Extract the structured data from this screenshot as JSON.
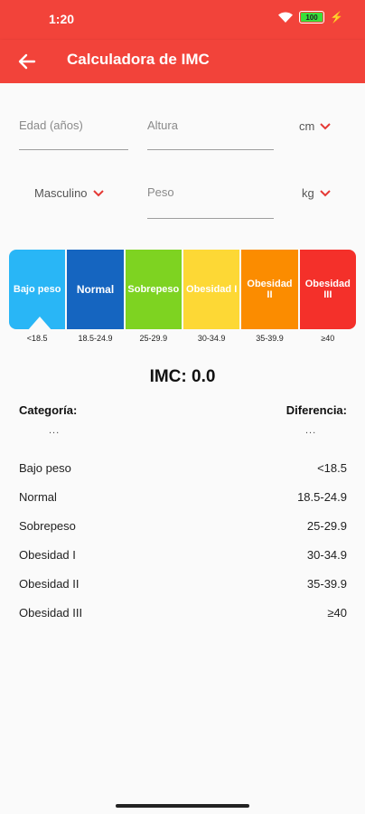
{
  "status": {
    "time": "1:20",
    "battery": "100"
  },
  "appbar": {
    "title": "Calculadora de IMC"
  },
  "form": {
    "age_placeholder": "Edad (años)",
    "height_placeholder": "Altura",
    "height_unit": "cm",
    "sex": "Masculino",
    "weight_placeholder": "Peso",
    "weight_unit": "kg"
  },
  "scale": {
    "segments": [
      {
        "label": "Bajo peso",
        "color": "#29b6f6"
      },
      {
        "label": "Normal",
        "color": "#1565c0"
      },
      {
        "label": "Sobrepeso",
        "color": "#7ed321"
      },
      {
        "label": "Obesidad I",
        "color": "#fdd835"
      },
      {
        "label": "Obesidad II",
        "color": "#fb8c00"
      },
      {
        "label": "Obesidad III",
        "color": "#f4302a"
      }
    ],
    "ranges": [
      "<18.5",
      "18.5-24.9",
      "25-29.9",
      "30-34.9",
      "35-39.9",
      "≥40"
    ]
  },
  "result": {
    "imc": "IMC: 0.0"
  },
  "table": {
    "category_header": "Categoría:",
    "difference_header": "Diferencia:",
    "category_value": "...",
    "difference_value": "...",
    "rows": [
      {
        "name": "Bajo peso",
        "range": "<18.5"
      },
      {
        "name": "Normal",
        "range": "18.5-24.9"
      },
      {
        "name": "Sobrepeso",
        "range": "25-29.9"
      },
      {
        "name": "Obesidad I",
        "range": "30-34.9"
      },
      {
        "name": "Obesidad II",
        "range": "35-39.9"
      },
      {
        "name": "Obesidad III",
        "range": "≥40"
      }
    ]
  }
}
